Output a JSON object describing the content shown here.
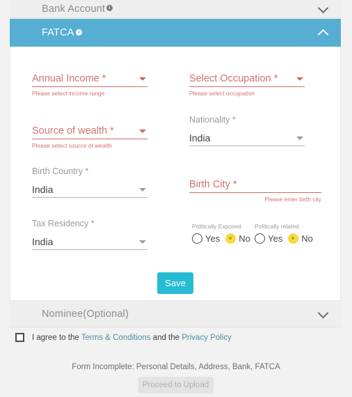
{
  "accordions": [
    {
      "id": "bank",
      "title": "Bank Account",
      "info_icon": "info-icon",
      "chevron": "chevron-down-icon",
      "state": "collapsed"
    },
    {
      "id": "fatca",
      "title": "FATCA",
      "info_icon": "info-icon",
      "chevron": "chevron-up-icon",
      "state": "expanded"
    },
    {
      "id": "nominee",
      "title": "Nominee(Optional)",
      "info_icon": "",
      "chevron": "chevron-down-icon",
      "state": "collapsed"
    }
  ],
  "fatca_form": {
    "annual_income": {
      "label": "Annual Income *",
      "value": "",
      "error": "Please select income range",
      "has_error": true,
      "control": "dropdown"
    },
    "occupation": {
      "label": "Select Occupation *",
      "value": "",
      "error": "Please select occupation",
      "has_error": true,
      "control": "dropdown"
    },
    "source_wealth": {
      "label": "Source of wealth *",
      "value": "",
      "error": "Please select source of wealth",
      "has_error": true,
      "control": "dropdown"
    },
    "nationality": {
      "label": "Nationality *",
      "value": "India",
      "error": "",
      "has_error": false,
      "control": "dropdown"
    },
    "birth_country": {
      "label": "Birth Country *",
      "value": "India",
      "error": "",
      "has_error": false,
      "control": "dropdown"
    },
    "birth_city": {
      "label": "Birth City *",
      "value": "",
      "error": "Please enter birth city",
      "has_error": true,
      "control": "text"
    },
    "tax_residency": {
      "label": "Tax Residency *",
      "value": "India",
      "error": "",
      "has_error": false,
      "control": "dropdown"
    },
    "politically_exposed": {
      "label": "Politically Exposed",
      "options": [
        "Yes",
        "No"
      ],
      "selected": "No"
    },
    "politically_related": {
      "label": "Politically related",
      "options": [
        "Yes",
        "No"
      ],
      "selected": "No"
    },
    "save_label": "Save"
  },
  "consent": {
    "text_before": "I agree to the ",
    "link_terms": "Terms & Conditions",
    "text_middle": " and the ",
    "link_privacy": "Privacy Policy",
    "checked": false
  },
  "footer": {
    "status": "Form Incomplete: Personal Details, Address, Bank, FATCA",
    "proceed_label": "Proceed to Upload",
    "proceed_disabled": true
  },
  "colors": {
    "accent_teal": "#56aed3",
    "save_teal": "#25bcd3",
    "error_red": "#d0736f",
    "radio_selected": "#f6d93f",
    "link": "#4b8fa3",
    "panel_grey": "#eeeeee",
    "page_bg": "#f2f2f2"
  }
}
